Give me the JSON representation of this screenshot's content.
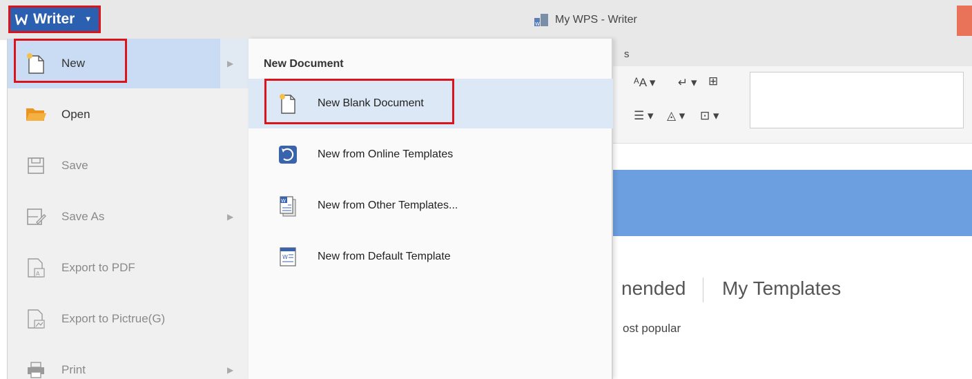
{
  "titlebar": {
    "app_button_label": "Writer",
    "window_title": "My WPS - Writer",
    "accent_color": "#2b5fb0",
    "highlight_color": "#d9141b"
  },
  "file_menu": {
    "items": [
      {
        "label": "New",
        "icon": "new-document-icon",
        "enabled": true,
        "has_submenu": true
      },
      {
        "label": "Open",
        "icon": "folder-open-icon",
        "enabled": true,
        "has_submenu": false
      },
      {
        "label": "Save",
        "icon": "save-icon",
        "enabled": false,
        "has_submenu": false
      },
      {
        "label": "Save As",
        "icon": "save-as-icon",
        "enabled": false,
        "has_submenu": true
      },
      {
        "label": "Export to PDF",
        "icon": "export-pdf-icon",
        "enabled": false,
        "has_submenu": false
      },
      {
        "label": "Export to Pictrue(G)",
        "icon": "export-picture-icon",
        "enabled": false,
        "has_submenu": false
      },
      {
        "label": "Print",
        "icon": "printer-icon",
        "enabled": false,
        "has_submenu": true
      }
    ]
  },
  "submenu": {
    "title": "New Document",
    "items": [
      {
        "label": "New Blank Document",
        "icon": "blank-document-icon"
      },
      {
        "label": "New from Online Templates",
        "icon": "online-templates-icon"
      },
      {
        "label": "New from Other Templates...",
        "icon": "other-templates-icon"
      },
      {
        "label": "New from Default Template",
        "icon": "default-template-icon"
      }
    ]
  },
  "background": {
    "ribbon_tab_fragment": "s",
    "template_tab_recommended": "nended",
    "template_tab_mine": "My Templates",
    "most_popular": "ost popular"
  }
}
